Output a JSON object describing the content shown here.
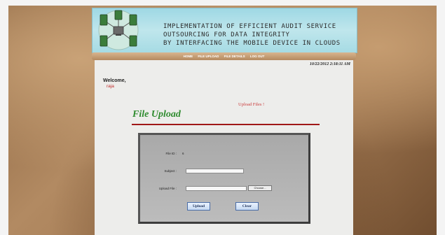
{
  "header": {
    "banner_lines": [
      "IMPLEMENTATION OF EFFICIENT AUDIT SERVICE",
      "OUTSOURCING FOR DATA INTEGRITY",
      "BY INTERFACING THE MOBILE DEVICE IN CLOUDS"
    ],
    "logo_icon": "network-servers-icon"
  },
  "nav": {
    "items": [
      "HOME",
      "FILE UPLOAD",
      "FILE DETAILS",
      "LOG OUT"
    ]
  },
  "status": {
    "timestamp": "10/22/2012 2:18:11 AM"
  },
  "user": {
    "welcome": "Welcome,",
    "name": "raja"
  },
  "main": {
    "upload_link": "Upload Files !",
    "page_title": "File Upload"
  },
  "form": {
    "file_id_label": "File ID :",
    "file_id_value": "6",
    "subject_label": "Subject :",
    "subject_value": "",
    "upload_file_label": "Upload File :",
    "upload_file_value": "",
    "choose_label": "Choose...",
    "upload_button": "Upload",
    "clear_button": "Clear"
  },
  "colors": {
    "banner": "#a6dbe4",
    "title_green": "#2e8b2e",
    "rule_red": "#a01818",
    "user_red": "#c02a2a"
  }
}
